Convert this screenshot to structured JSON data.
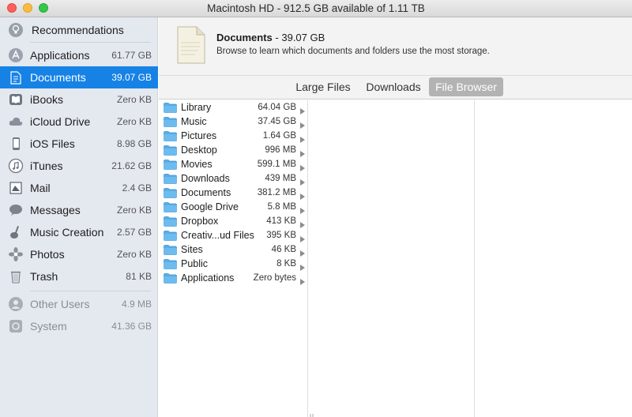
{
  "window": {
    "title": "Macintosh HD - 912.5 GB available of 1.11 TB"
  },
  "sidebar": {
    "recommendations_label": "Recommendations",
    "items": [
      {
        "label": "Applications",
        "size": "61.77 GB",
        "icon": "applications-icon"
      },
      {
        "label": "Documents",
        "size": "39.07 GB",
        "icon": "documents-icon",
        "selected": true
      },
      {
        "label": "iBooks",
        "size": "Zero KB",
        "icon": "ibooks-icon"
      },
      {
        "label": "iCloud Drive",
        "size": "Zero KB",
        "icon": "icloud-icon"
      },
      {
        "label": "iOS Files",
        "size": "8.98 GB",
        "icon": "iphone-icon"
      },
      {
        "label": "iTunes",
        "size": "21.62 GB",
        "icon": "itunes-icon"
      },
      {
        "label": "Mail",
        "size": "2.4 GB",
        "icon": "mail-icon"
      },
      {
        "label": "Messages",
        "size": "Zero KB",
        "icon": "messages-icon"
      },
      {
        "label": "Music Creation",
        "size": "2.57 GB",
        "icon": "guitar-icon"
      },
      {
        "label": "Photos",
        "size": "Zero KB",
        "icon": "photos-icon"
      },
      {
        "label": "Trash",
        "size": "81 KB",
        "icon": "trash-icon"
      }
    ],
    "other_items": [
      {
        "label": "Other Users",
        "size": "4.9 MB",
        "icon": "users-icon"
      },
      {
        "label": "System",
        "size": "41.36 GB",
        "icon": "system-icon"
      }
    ]
  },
  "header": {
    "title": "Documents",
    "title_size": "- 39.07 GB",
    "description": "Browse to learn which documents and folders use the most storage."
  },
  "tabs": [
    {
      "label": "Large Files",
      "active": false
    },
    {
      "label": "Downloads",
      "active": false
    },
    {
      "label": "File Browser",
      "active": true
    }
  ],
  "files": [
    {
      "name": "Library",
      "size": "64.04 GB"
    },
    {
      "name": "Music",
      "size": "37.45 GB"
    },
    {
      "name": "Pictures",
      "size": "1.64 GB"
    },
    {
      "name": "Desktop",
      "size": "996 MB"
    },
    {
      "name": "Movies",
      "size": "599.1 MB"
    },
    {
      "name": "Downloads",
      "size": "439 MB"
    },
    {
      "name": "Documents",
      "size": "381.2 MB"
    },
    {
      "name": "Google Drive",
      "size": "5.8 MB"
    },
    {
      "name": "Dropbox",
      "size": "413 KB"
    },
    {
      "name": "Creativ...ud Files",
      "size": "395 KB"
    },
    {
      "name": "Sites",
      "size": "46 KB"
    },
    {
      "name": "Public",
      "size": "8 KB"
    },
    {
      "name": "Applications",
      "size": "Zero bytes"
    }
  ],
  "colors": {
    "accent": "#1682e6",
    "folder": "#5aaee6",
    "sidebar_bg": "#e4e8ef"
  }
}
